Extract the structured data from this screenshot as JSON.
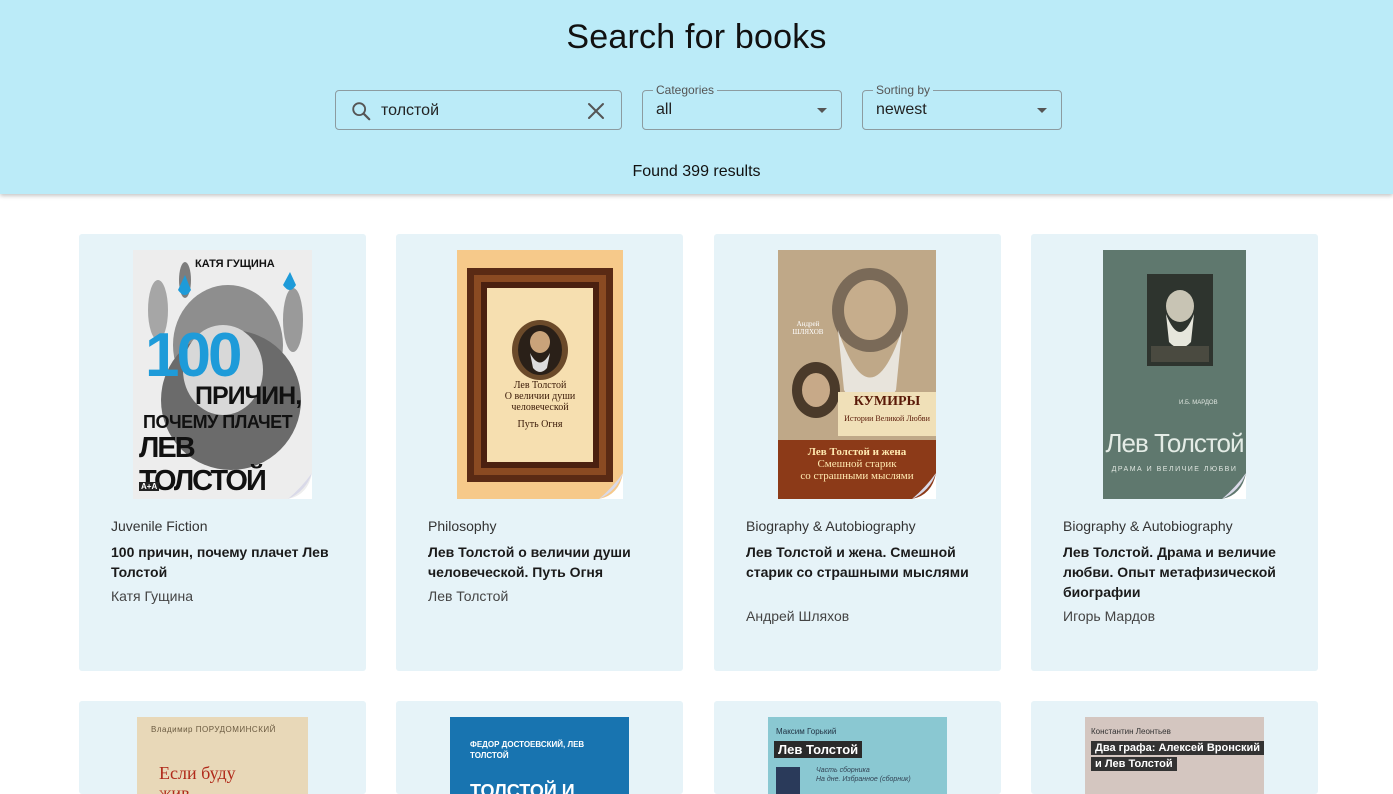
{
  "header": {
    "title": "Search for books",
    "search_value": "толстой",
    "categories_label": "Categories",
    "categories_value": "all",
    "sorting_label": "Sorting by",
    "sorting_value": "newest",
    "found_text": "Found 399 results"
  },
  "books": [
    {
      "category": "Juvenile Fiction",
      "title": "100 причин, почему плачет Лев Толстой",
      "author": "Катя Гущина",
      "cover": {
        "top_text": "КАТЯ ГУЩИНА",
        "big": "100",
        "line1": "ПРИЧИН,",
        "line2": "ПОЧЕМУ ПЛАЧЕТ",
        "line3": "ЛЕВ ТОЛСТОЙ",
        "mark": "А+А"
      }
    },
    {
      "category": "Philosophy",
      "title": "Лев Толстой о величии души человеческой. Путь Огня",
      "author": "Лев Толстой",
      "cover": {
        "line1": "Лев Толстой",
        "line2": "О величии души",
        "line3": "человеческой",
        "line4": "Путь Огня"
      }
    },
    {
      "category": "Biography & Autobiography",
      "title": "Лев Толстой и жена. Смешной старик со страшными мыслями",
      "author": "Андрей Шляхов",
      "cover": {
        "author": "Андрей ШЛЯХОВ",
        "series": "КУМИРЫ",
        "sub": "Истории Великой Любви",
        "line1": "Лев Толстой и жена",
        "line2": "Смешной старик",
        "line3": "со страшными мыслями"
      }
    },
    {
      "category": "Biography & Autobiography",
      "title": "Лев Толстой. Драма и величие любви. Опыт метафизической биографии",
      "author": "Игорь Мардов",
      "cover": {
        "author": "И.Б. МАРДОВ",
        "line1": "Лев Толстой",
        "line2": "ДРАМА И ВЕЛИЧИЕ ЛЮБВИ"
      }
    },
    {
      "cover": {
        "author": "Владимир ПОРУДОМИНСКИЙ",
        "line1": "Если буду",
        "line2": "жив"
      }
    },
    {
      "cover": {
        "author": "ФЕДОР ДОСТОЕВСКИЙ, ЛЕВ ТОЛСТОЙ",
        "line1": "ТОЛСТОЙ И"
      }
    },
    {
      "cover": {
        "author": "Максим Горький",
        "line1": "Лев Толстой",
        "line2": "Часть сборника",
        "line3": "На дне. Избранное (сборник)"
      }
    },
    {
      "cover": {
        "author": "Константин Леонтьев",
        "line1": "Два графа: Алексей Вронский",
        "line2": "и Лев Толстой"
      }
    }
  ]
}
